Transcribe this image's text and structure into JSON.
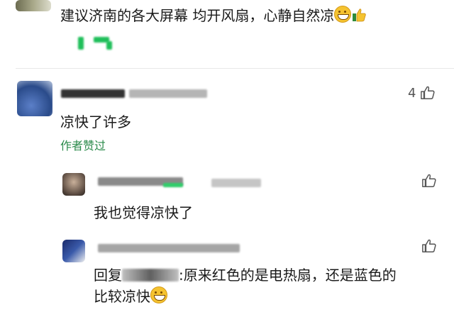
{
  "top_comment": {
    "text": "建议济南的各大屏幕 均开风扇，心静自然凉"
  },
  "comment1": {
    "text": "凉快了许多",
    "like_count": "4",
    "author_liked": "作者赞过"
  },
  "reply1": {
    "text": "我也觉得凉快了"
  },
  "reply2": {
    "reply_prefix": "回复",
    "text_line1": ":原来红色的是电热扇，还是蓝色的",
    "text_line2": "比较凉快"
  },
  "colors": {
    "author_liked": "#2a8a4a",
    "like_icon": "#555555"
  },
  "icons": [
    "grin-emoji",
    "thumbs-up-emoji",
    "thumbs-up-icon"
  ]
}
